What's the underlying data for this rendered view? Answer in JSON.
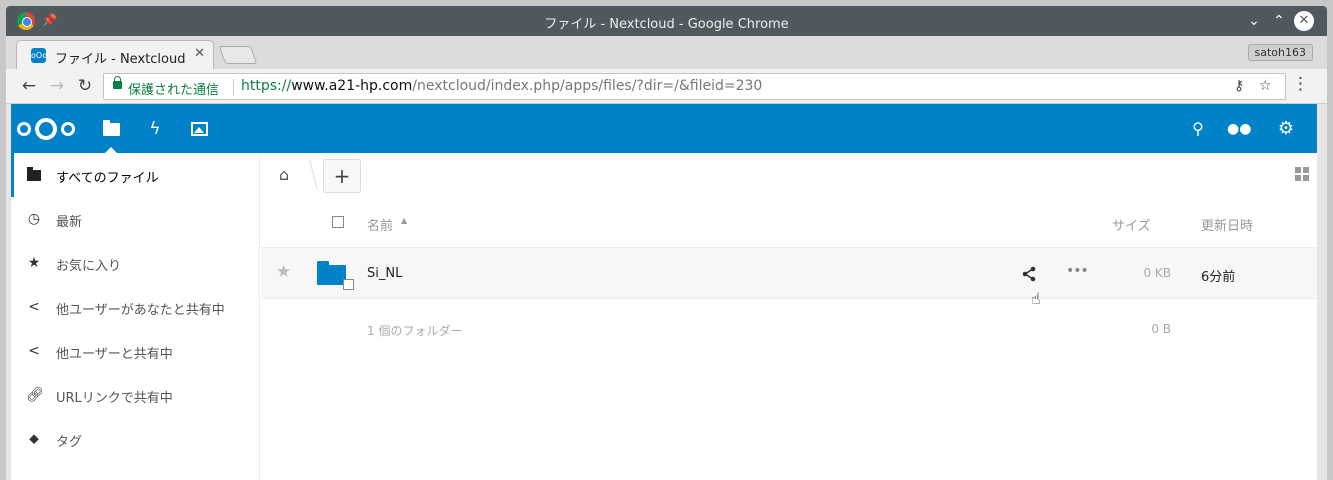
{
  "window": {
    "title": "ファイル - Nextcloud - Google Chrome",
    "controls": {
      "minimize": "⌄",
      "maximize": "⌃",
      "close": "✕"
    }
  },
  "tabs": [
    {
      "label": "ファイル - Nextcloud",
      "close": "✕",
      "favicon": "nextcloud-icon"
    }
  ],
  "profile": {
    "name": "satoh163"
  },
  "omnibox": {
    "security_label": "保護された通信",
    "url_scheme": "https://",
    "url_host": "www.a21-hp.com",
    "url_path": "/nextcloud/index.php/apps/files/?dir=/&fileid=230"
  },
  "header": {
    "apps": [
      {
        "name": "files-icon",
        "active": true
      },
      {
        "name": "activity-icon",
        "active": false
      },
      {
        "name": "gallery-icon",
        "active": false
      }
    ],
    "right_icons": [
      "search-icon",
      "contacts-icon",
      "settings-icon"
    ],
    "accent": "#0082c9"
  },
  "sidebar": {
    "items": [
      {
        "label": "すべてのファイル",
        "icon": "folder-icon",
        "active": true
      },
      {
        "label": "最新",
        "icon": "clock-icon",
        "active": false
      },
      {
        "label": "お気に入り",
        "icon": "star-icon",
        "active": false
      },
      {
        "label": "他ユーザーがあなたと共有中",
        "icon": "share-icon",
        "active": false
      },
      {
        "label": "他ユーザーと共有中",
        "icon": "share-icon",
        "active": false
      },
      {
        "label": "URLリンクで共有中",
        "icon": "link-icon",
        "active": false
      },
      {
        "label": "タグ",
        "icon": "tag-icon",
        "active": false
      }
    ]
  },
  "toolbar": {
    "add_label": "+"
  },
  "table": {
    "headers": {
      "name": "名前",
      "size": "サイズ",
      "modified": "更新日時"
    },
    "rows": [
      {
        "name": "Si_NL",
        "size": "0 KB",
        "modified": "6分前",
        "type": "folder"
      }
    ],
    "summary": {
      "text": "1 個のフォルダー",
      "size": "0 B"
    }
  }
}
